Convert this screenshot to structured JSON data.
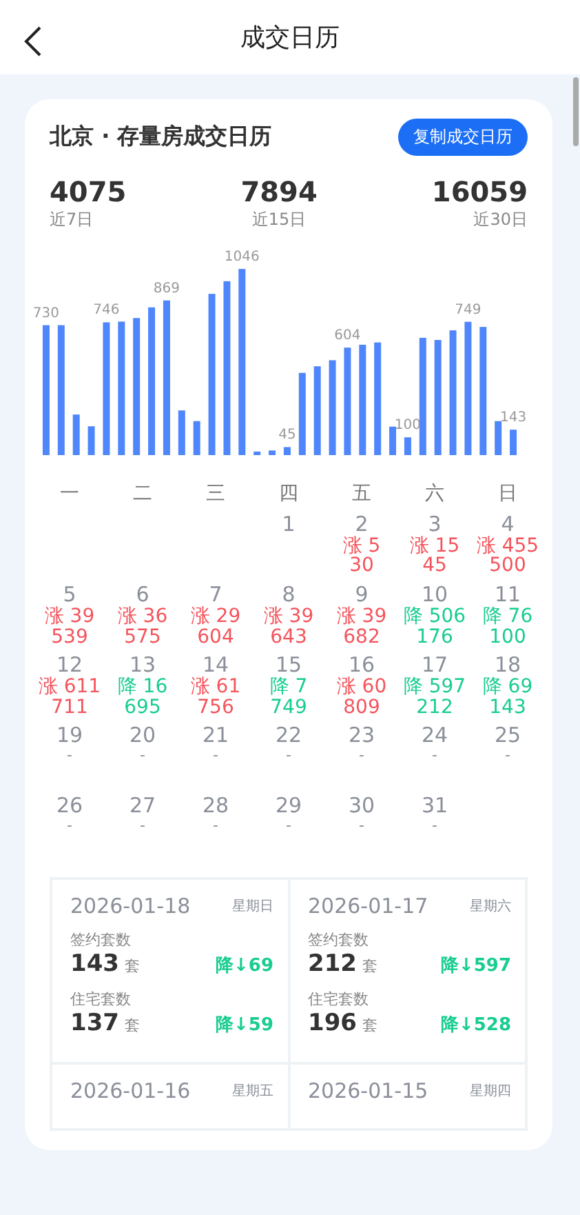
{
  "header": {
    "title": "成交日历"
  },
  "card": {
    "title": "北京 · 存量房成交日历",
    "copy_button": "复制成交日历",
    "stats": [
      {
        "value": "4075",
        "label": "近7日"
      },
      {
        "value": "7894",
        "label": "近15日"
      },
      {
        "value": "16059",
        "label": "近30日"
      }
    ],
    "bar_labels": [
      "730",
      "746",
      "869",
      "1046",
      "45",
      "604",
      "100",
      "749",
      "143"
    ],
    "weekdays": [
      "一",
      "二",
      "三",
      "四",
      "五",
      "六",
      "日"
    ],
    "weeks": [
      [
        {
          "day": "1",
          "kind": "none"
        },
        {
          "day": "2",
          "kind": "up",
          "change": "涨 5",
          "value": "30"
        },
        {
          "day": "3",
          "kind": "up",
          "change": "涨 15",
          "value": "45"
        },
        {
          "day": "4",
          "kind": "up",
          "change": "涨 455",
          "value": "500"
        }
      ],
      [
        {
          "day": "5",
          "kind": "up",
          "change": "涨 39",
          "value": "539"
        },
        {
          "day": "6",
          "kind": "up",
          "change": "涨 36",
          "value": "575"
        },
        {
          "day": "7",
          "kind": "up",
          "change": "涨 29",
          "value": "604"
        },
        {
          "day": "8",
          "kind": "up",
          "change": "涨 39",
          "value": "643"
        },
        {
          "day": "9",
          "kind": "up",
          "change": "涨 39",
          "value": "682"
        },
        {
          "day": "10",
          "kind": "down",
          "change": "降 506",
          "value": "176"
        },
        {
          "day": "11",
          "kind": "down",
          "change": "降 76",
          "value": "100"
        }
      ],
      [
        {
          "day": "12",
          "kind": "up",
          "change": "涨 611",
          "value": "711"
        },
        {
          "day": "13",
          "kind": "down",
          "change": "降 16",
          "value": "695"
        },
        {
          "day": "14",
          "kind": "up",
          "change": "涨 61",
          "value": "756"
        },
        {
          "day": "15",
          "kind": "down",
          "change": "降 7",
          "value": "749"
        },
        {
          "day": "16",
          "kind": "up",
          "change": "涨 60",
          "value": "809"
        },
        {
          "day": "17",
          "kind": "down",
          "change": "降 597",
          "value": "212"
        },
        {
          "day": "18",
          "kind": "down",
          "change": "降 69",
          "value": "143"
        }
      ],
      [
        {
          "day": "19",
          "kind": "empty",
          "value": "-"
        },
        {
          "day": "20",
          "kind": "empty",
          "value": "-"
        },
        {
          "day": "21",
          "kind": "empty",
          "value": "-"
        },
        {
          "day": "22",
          "kind": "empty",
          "value": "-"
        },
        {
          "day": "23",
          "kind": "empty",
          "value": "-"
        },
        {
          "day": "24",
          "kind": "empty",
          "value": "-"
        },
        {
          "day": "25",
          "kind": "empty",
          "value": "-"
        }
      ],
      [
        {
          "day": "26",
          "kind": "empty",
          "value": "-"
        },
        {
          "day": "27",
          "kind": "empty",
          "value": "-"
        },
        {
          "day": "28",
          "kind": "empty",
          "value": "-"
        },
        {
          "day": "29",
          "kind": "empty",
          "value": "-"
        },
        {
          "day": "30",
          "kind": "empty",
          "value": "-"
        },
        {
          "day": "31",
          "kind": "empty",
          "value": "-"
        }
      ]
    ],
    "details": [
      {
        "date": "2026-01-18",
        "weekday": "星期日",
        "metrics": [
          {
            "label": "签约套数",
            "value": "143",
            "unit": "套",
            "kind": "down",
            "change": "降↓69"
          },
          {
            "label": "住宅套数",
            "value": "137",
            "unit": "套",
            "kind": "down",
            "change": "降↓59"
          }
        ]
      },
      {
        "date": "2026-01-17",
        "weekday": "星期六",
        "metrics": [
          {
            "label": "签约套数",
            "value": "212",
            "unit": "套",
            "kind": "down",
            "change": "降↓597"
          },
          {
            "label": "住宅套数",
            "value": "196",
            "unit": "套",
            "kind": "down",
            "change": "降↓528"
          }
        ]
      },
      {
        "date": "2026-01-16",
        "weekday": "星期五"
      },
      {
        "date": "2026-01-15",
        "weekday": "星期四"
      }
    ]
  }
}
